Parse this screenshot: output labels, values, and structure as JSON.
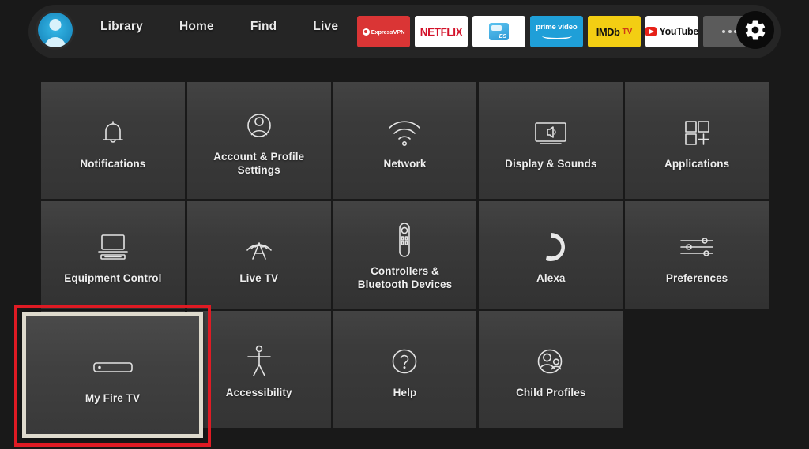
{
  "nav": {
    "avatar_name": "profile-avatar",
    "links": [
      {
        "label": "Library"
      },
      {
        "label": "Home"
      },
      {
        "label": "Find"
      },
      {
        "label": "Live"
      }
    ],
    "apps": [
      {
        "name": "expressvpn",
        "label": "ExpressVPN",
        "bg": "#da3535"
      },
      {
        "name": "netflix",
        "label": "NETFLIX",
        "bg": "#ffffff"
      },
      {
        "name": "es-file-explorer",
        "label": "ES",
        "bg": "#ffffff"
      },
      {
        "name": "prime-video",
        "label": "prime video",
        "bg": "#1f9fd8"
      },
      {
        "name": "imdb-tv",
        "label": "IMDb",
        "label2": "TV",
        "bg": "#f3ce13"
      },
      {
        "name": "youtube",
        "label": "YouTube",
        "bg": "#ffffff"
      }
    ],
    "more_label": "more-options",
    "settings_label": "settings-gear"
  },
  "grid": {
    "tiles": [
      {
        "label": "Notifications",
        "icon": "bell-icon"
      },
      {
        "label": "Account & Profile Settings",
        "icon": "account-profile-icon"
      },
      {
        "label": "Network",
        "icon": "wifi-icon"
      },
      {
        "label": "Display & Sounds",
        "icon": "display-sounds-icon"
      },
      {
        "label": "Applications",
        "icon": "applications-icon"
      },
      {
        "label": "Equipment Control",
        "icon": "equipment-control-icon"
      },
      {
        "label": "Live TV",
        "icon": "broadcast-tower-icon"
      },
      {
        "label": "Controllers & Bluetooth Devices",
        "icon": "remote-control-icon"
      },
      {
        "label": "Alexa",
        "icon": "alexa-ring-icon"
      },
      {
        "label": "Preferences",
        "icon": "sliders-icon"
      },
      {
        "label": "Accessibility",
        "icon": "accessibility-icon"
      },
      {
        "label": "Help",
        "icon": "question-mark-icon"
      },
      {
        "label": "Child Profiles",
        "icon": "child-profiles-icon"
      }
    ]
  },
  "focused": {
    "label": "My Fire TV",
    "icon": "fire-tv-stick-icon",
    "highlight_color": "#e01b24",
    "focus_border_color": "#dedacd"
  },
  "colors": {
    "background": "#191919",
    "navbar": "#252525",
    "tile": "#3b3b3b",
    "text": "#efefef"
  }
}
